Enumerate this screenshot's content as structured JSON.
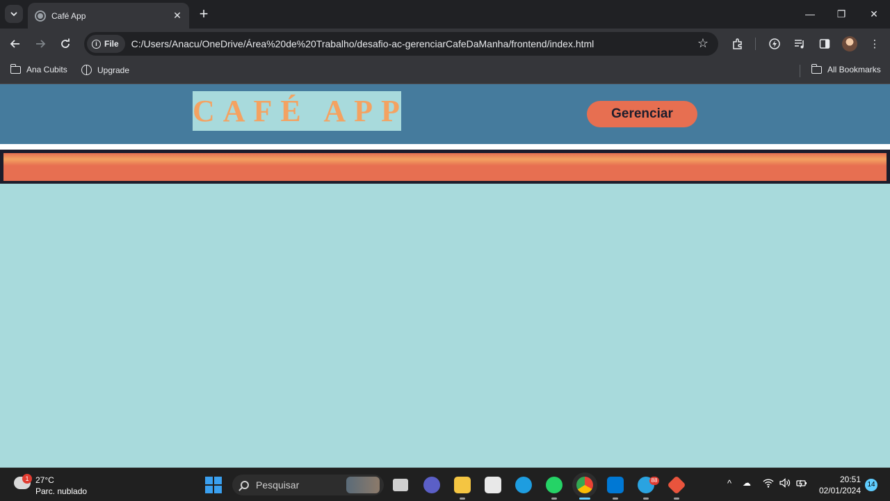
{
  "browser": {
    "tab": {
      "title": "Café App"
    },
    "address": {
      "chip_label": "File",
      "url": "C:/Users/Anacu/OneDrive/Área%20de%20Trabalho/desafio-ac-gerenciarCafeDaManha/frontend/index.html"
    },
    "bookmarks": [
      {
        "label": "Ana Cubits"
      },
      {
        "label": "Upgrade"
      }
    ],
    "all_bookmarks_label": "All Bookmarks"
  },
  "app": {
    "brand": "CAFÉ APP",
    "manage_button": "Gerenciar",
    "colors": {
      "header": "#457b9d",
      "background": "#a8dadc",
      "brand_text": "#f4a261",
      "accent": "#e76f51",
      "dark": "#1d1d2c"
    }
  },
  "taskbar": {
    "weather": {
      "badge": "1",
      "temp": "27°C",
      "desc": "Parc. nublado"
    },
    "search_placeholder": "Pesquisar",
    "telegram_badge": "88",
    "clock": {
      "time": "20:51",
      "date": "02/01/2024"
    },
    "notifications": "14"
  }
}
